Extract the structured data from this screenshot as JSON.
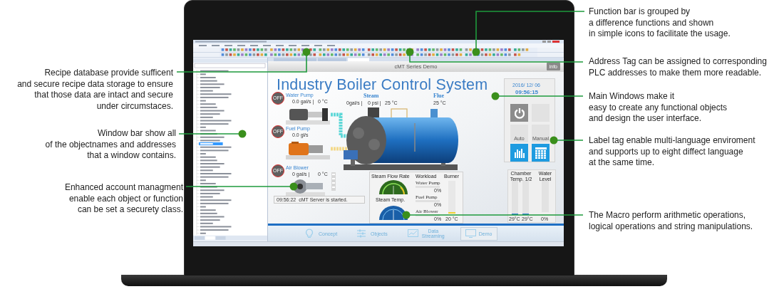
{
  "callouts_left": [
    {
      "lines": [
        "Recipe database provide sufficent",
        "and secure recipe data storage to ensure",
        "that those data are intact and secure",
        "under circumstaces."
      ]
    },
    {
      "lines": [
        "Window bar show all",
        "of the objectnames and addresses",
        "that a window contains."
      ]
    },
    {
      "lines": [
        "Enhanced account managment",
        "enable each object or function",
        "can be set a securety class."
      ]
    }
  ],
  "callouts_right": [
    {
      "lines": [
        "Function bar is grouped by",
        "a difference functions and shown",
        "in simple icons to facilitate the usage."
      ]
    },
    {
      "lines": [
        "Address Tag can be assigned to corresponding",
        "PLC addresses to make them more readable."
      ]
    },
    {
      "lines": [
        "Main Windows make it",
        "easy to create any functional objects",
        "and design the user interface."
      ]
    },
    {
      "lines": [
        "Label tag enable multi-language enviroment",
        "and supports up to eight diffect language",
        "at the same time."
      ]
    },
    {
      "lines": [
        "The Macro perform arithmetic operations,",
        "logical operations and string manipulations."
      ]
    }
  ],
  "app": {
    "hmi": {
      "header": "cMT Series Demo",
      "info_button": "info",
      "title": "Industry Boiler Control System",
      "devices": [
        {
          "name": "Water Pump",
          "switch": "OFF",
          "on": false,
          "readings": [
            "0.0 gal/s |",
            "0 °C"
          ]
        },
        {
          "name": "Fuel Pump",
          "switch": "OFF",
          "on": false,
          "readings": [
            "0.0 gl/s"
          ]
        },
        {
          "name": "Air Blower",
          "switch": "OFF",
          "on": false,
          "readings": [
            "0 gal/s |",
            "0 °C"
          ]
        }
      ],
      "steam": {
        "label": "Steam",
        "readings": [
          "0gal/s |",
          "0 psi |",
          "25 °C"
        ]
      },
      "flue": {
        "label": "Flue",
        "reading": "25 °C"
      },
      "message": {
        "time": "09:56:22",
        "text": "cMT Server is started."
      },
      "flow_title": "Steam Flow Rate",
      "temp_title": "Steam Temp.",
      "workload": {
        "title": "Workload",
        "items": [
          {
            "label": "Water Pump",
            "reading": "0%",
            "level": 0
          },
          {
            "label": "Fuel Pump",
            "reading": "0%",
            "level": 0
          },
          {
            "label": "Air Blower",
            "reading": "0%",
            "level": 0
          }
        ]
      },
      "burner": {
        "title": "Burner",
        "level": 0.04,
        "reading": "20 °C"
      },
      "clock": {
        "date": "2016/ 12/ 06",
        "time": "09:56:15"
      },
      "modes": [
        {
          "label": "Auto",
          "selected": false
        },
        {
          "label": "Manual",
          "selected": false
        }
      ],
      "chamber": {
        "title": "Chamber Temp. 1/2",
        "bars": [
          {
            "level": 0.04,
            "reading": "29°C"
          },
          {
            "level": 0.04,
            "reading": "29°C"
          }
        ]
      },
      "water": {
        "title": "Water Level",
        "level": 0,
        "reading": "0%"
      }
    },
    "nav": [
      {
        "label": "Concept",
        "selected": false
      },
      {
        "label": "Objects",
        "selected": false
      },
      {
        "label": "Data Streaming",
        "selected": false
      },
      {
        "label": "Demo",
        "selected": true
      }
    ]
  }
}
